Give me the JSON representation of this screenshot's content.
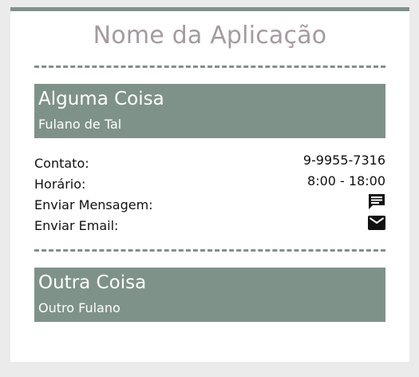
{
  "app": {
    "title": "Nome da Aplicação"
  },
  "colors": {
    "accent": "#7f928a",
    "title": "#a59aa0",
    "background": "#ebebeb",
    "card": "#ffffff"
  },
  "items": [
    {
      "title": "Alguma Coisa",
      "subtitle": "Fulano de Tal",
      "details": {
        "contact_label": "Contato:",
        "contact_value": "9-9955-7316",
        "hours_label": "Horário:",
        "hours_value": "8:00 - 18:00",
        "message_label": "Enviar Mensagem:",
        "message_icon": "chat-icon",
        "email_label": "Enviar Email:",
        "email_icon": "mail-icon"
      }
    },
    {
      "title": "Outra Coisa",
      "subtitle": "Outro Fulano"
    }
  ]
}
